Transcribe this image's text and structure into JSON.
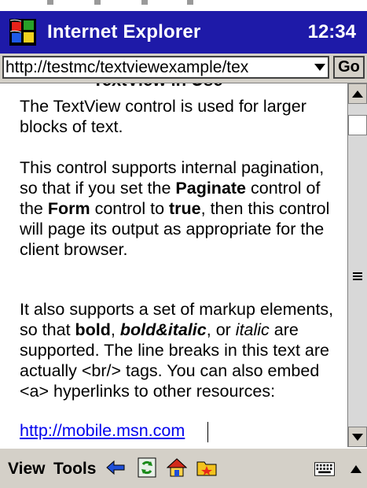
{
  "titlebar": {
    "app_title": "Internet Explorer",
    "clock": "12:34",
    "logo_icon": "windows-flag-icon",
    "color": "#1e1aa8"
  },
  "addressbar": {
    "url": "http://testmc/textviewexample/tex",
    "go_label": "Go",
    "dropdown_icon": "triangle-down-icon"
  },
  "content": {
    "heading_partial": "TextView in Use",
    "p1": "The TextView control is used for larger blocks of text.",
    "p2": {
      "a": "This control supports internal pagination, so that if you set the ",
      "b": "Paginate",
      "c": " control of the ",
      "d": "Form",
      "e": " control to ",
      "f": "true",
      "g": ", then this control will page its output as appropriate for the client browser."
    },
    "p3": {
      "a": "It also supports a set of markup elements, so that ",
      "b": "bold",
      "c": ", ",
      "d": "bold&italic",
      "e": ", or ",
      "f": "italic",
      "g": " are supported. The line breaks in this text are actually <br/> tags. You can also embed <a> hyperlinks to other resources:"
    },
    "link": "http://mobile.msn.com",
    "link_color": "#0000ee"
  },
  "commandbar": {
    "view_label": "View",
    "tools_label": "Tools",
    "icons": [
      "back-arrow-icon",
      "refresh-icon",
      "home-icon",
      "favorites-icon",
      "keyboard-icon",
      "sip-up-arrow-icon"
    ]
  }
}
